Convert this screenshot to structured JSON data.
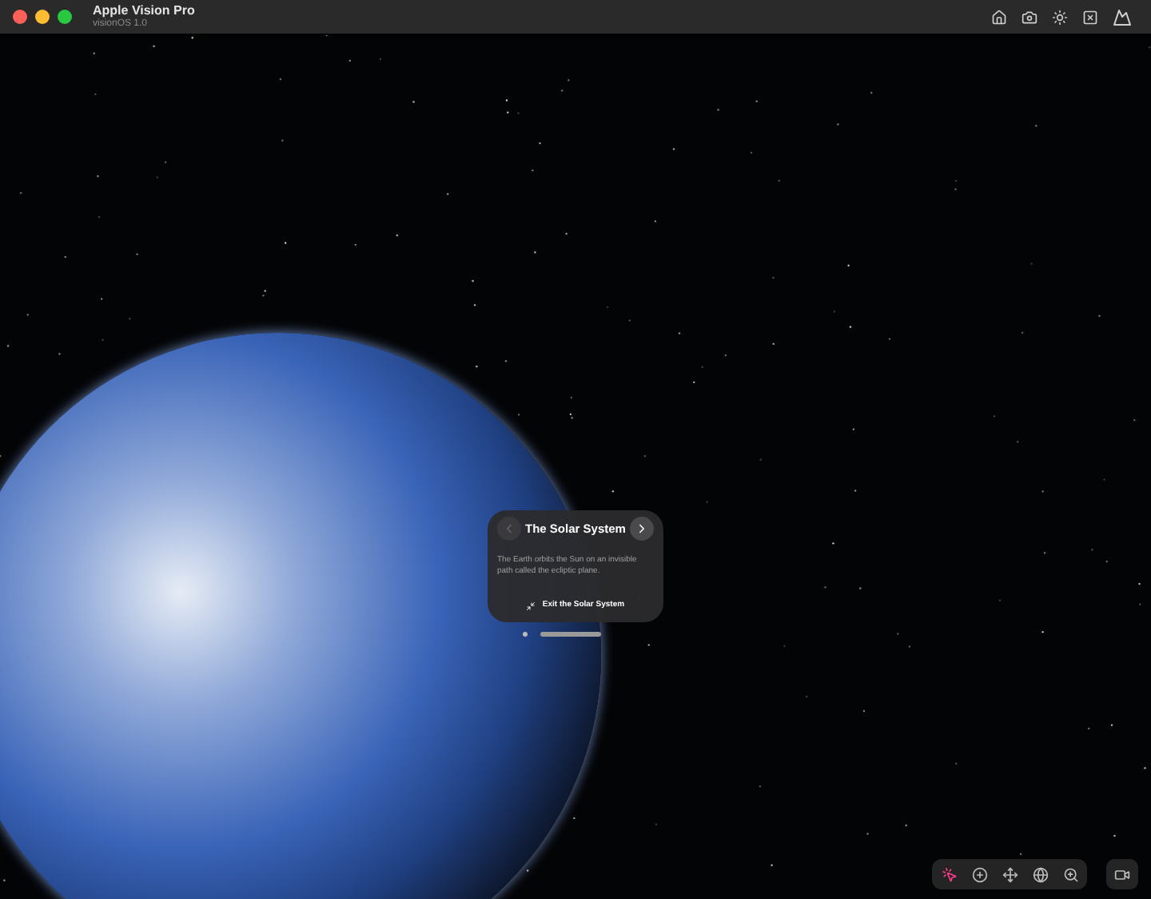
{
  "window": {
    "title": "Apple Vision Pro",
    "subtitle": "visionOS 1.0"
  },
  "panel": {
    "title": "The Solar System",
    "previous": {
      "disabled": true
    },
    "next": {
      "disabled": false
    },
    "body": "The Earth orbits the Sun on an invisible path called the ecliptic plane.",
    "exit_label": "Exit the Solar System"
  },
  "tools": [
    {
      "kind": "interact",
      "selected": true
    },
    {
      "kind": "tilt",
      "selected": false
    },
    {
      "kind": "pan",
      "selected": false
    },
    {
      "kind": "orbit",
      "selected": false
    },
    {
      "kind": "zoom",
      "selected": false
    }
  ]
}
